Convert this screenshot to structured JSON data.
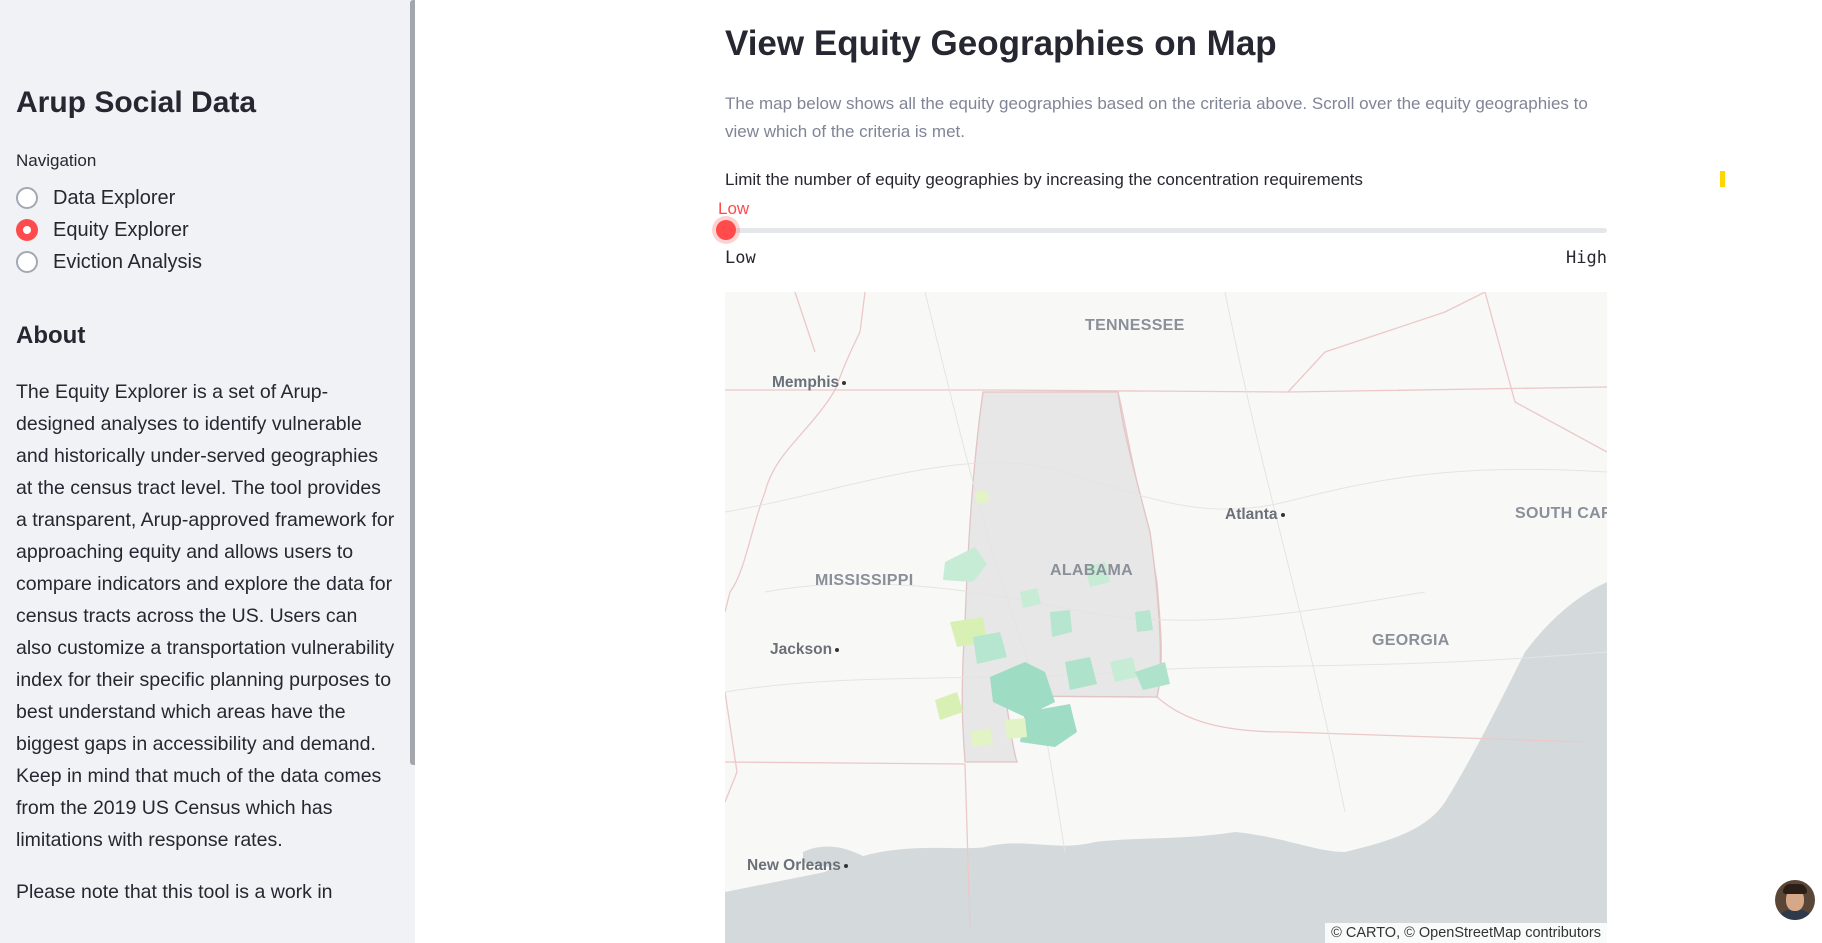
{
  "sidebar": {
    "title": "Arup Social Data",
    "nav_label": "Navigation",
    "nav_items": [
      {
        "label": "Data Explorer",
        "selected": false
      },
      {
        "label": "Equity Explorer",
        "selected": true
      },
      {
        "label": "Eviction Analysis",
        "selected": false
      }
    ],
    "about_heading": "About",
    "about_text": "The Equity Explorer is a set of Arup-designed analyses to identify vulnerable and historically under-served geographies at the census tract level. The tool provides a transparent, Arup-approved framework for approaching equity and allows users to compare indicators and explore the data for census tracts across the US. Users can also customize a transportation vulnerability index for their specific planning purposes to best understand which areas have the biggest gaps in accessibility and demand. Keep in mind that much of the data comes from the 2019 US Census which has limitations with response rates.",
    "about_text_2": "Please note that this tool is a work in"
  },
  "main": {
    "title": "View Equity Geographies on Map",
    "description": "The map below shows all the equity geographies based on the criteria above. Scroll over the equity geographies to view which of the criteria is met.",
    "slider": {
      "label": "Limit the number of equity geographies by increasing the concentration requirements",
      "value": "Low",
      "min_label": "Low",
      "max_label": "High",
      "position": 0
    }
  },
  "map": {
    "states": [
      "TENNESSEE",
      "ALABAMA",
      "MISSISSIPPI",
      "GEORGIA",
      "SOUTH CARO"
    ],
    "cities": [
      "Memphis",
      "Atlanta",
      "Jackson",
      "New Orleans"
    ],
    "attribution": "© CARTO, © OpenStreetMap contributors"
  },
  "colors": {
    "accent": "#ff4b4b",
    "sidebar_bg": "#f0f2f6",
    "equity_fill": "#9edcc4",
    "equity_fill_light": "#d9f0b4"
  }
}
